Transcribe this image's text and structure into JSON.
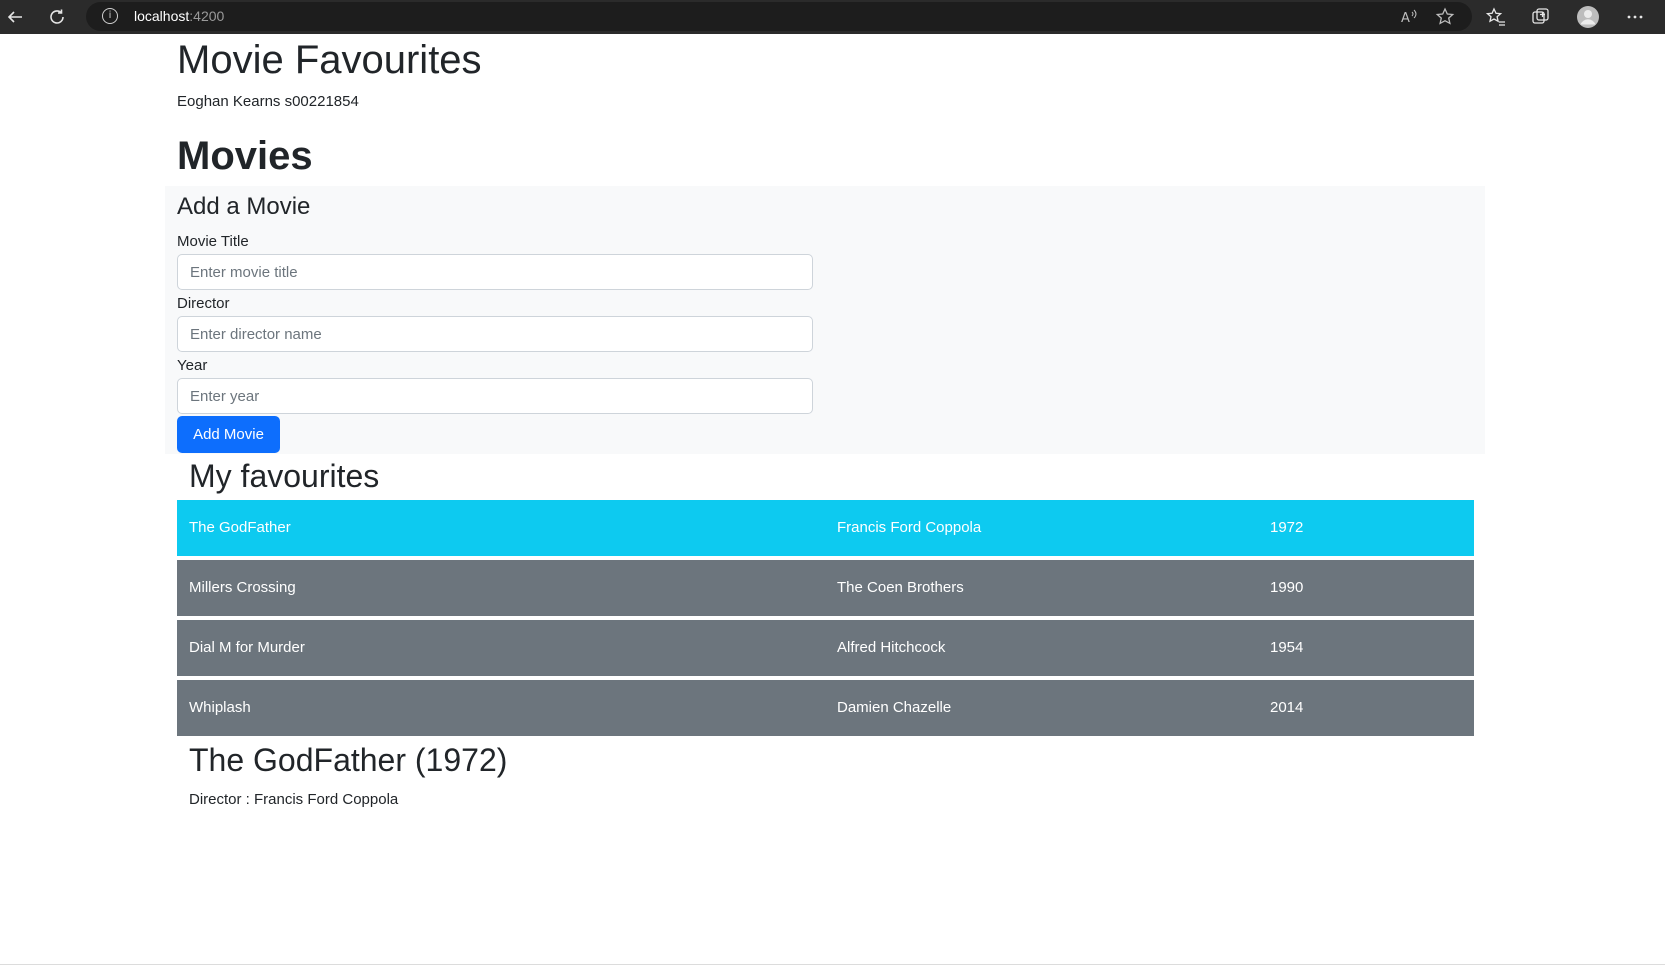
{
  "browser": {
    "url_host": "localhost",
    "url_port": ":4200"
  },
  "page": {
    "title": "Movie Favourites",
    "student": "Eoghan Kearns s00221854",
    "movies_heading": "Movies"
  },
  "add_form": {
    "heading": "Add a Movie",
    "title_label": "Movie Title",
    "title_placeholder": "Enter movie title",
    "director_label": "Director",
    "director_placeholder": "Enter director name",
    "year_label": "Year",
    "year_placeholder": "Enter year",
    "submit_label": "Add Movie"
  },
  "favourites": {
    "heading": "My favourites",
    "movies": [
      {
        "title": "The GodFather",
        "director": "Francis Ford Coppola",
        "year": "1972",
        "selected": true
      },
      {
        "title": "Millers Crossing",
        "director": "The Coen Brothers",
        "year": "1990",
        "selected": false
      },
      {
        "title": "Dial M for Murder",
        "director": "Alfred Hitchcock",
        "year": "1954",
        "selected": false
      },
      {
        "title": "Whiplash",
        "director": "Damien Chazelle",
        "year": "2014",
        "selected": false
      }
    ]
  },
  "detail": {
    "title": "The GodFather (1972)",
    "director": "Director : Francis Ford Coppola"
  },
  "colors": {
    "selected_row": "#0dcaf0",
    "row": "#6c757d",
    "primary_button": "#0d6efd",
    "panel_bg": "#f8f9fa"
  }
}
